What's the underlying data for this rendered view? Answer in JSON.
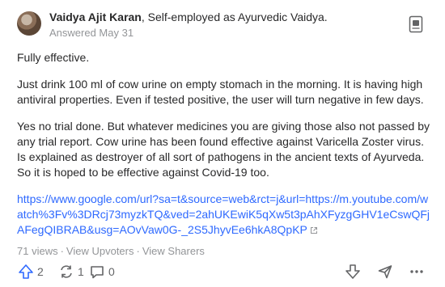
{
  "answer": {
    "author_name": "Vaidya Ajit Karan",
    "credential": ", Self-employed as Ayurvedic Vaidya.",
    "answered": "Answered May 31",
    "paragraphs": [
      "Fully effective.",
      "Just drink 100 ml of cow urine on empty stomach in the morning. It is having high antiviral properties. Even if tested positive, the user will turn negative in few days.",
      "Yes no trial done. But whatever medicines you are giving those also not passed by any trial report. Cow urine has been found effective against Varicella Zoster virus. Is explained as destroyer of all sort of pathogens in the ancient texts of Ayurveda. So it is hoped to be effective against Covid-19 too."
    ],
    "link": "https://www.google.com/url?sa=t&source=web&rct=j&url=https://m.youtube.com/watch%3Fv%3DRcj73myzkTQ&ved=2ahUKEwiK5qXw5t3pAhXFyzgGHV1eCswQFjAFegQIBRAB&usg=AOvVaw0G-_2S5JhyvEe6hkA8QpKP"
  },
  "meta": {
    "views": "71 views",
    "separator": "·",
    "view_upvoters": "View Upvoters",
    "view_sharers": "View Sharers"
  },
  "actions": {
    "upvotes": "2",
    "reshares": "1",
    "comments": "0"
  },
  "colors": {
    "link": "#2e69ff",
    "muted": "#939598",
    "upvote": "#2e69ff",
    "icon": "#636466"
  }
}
